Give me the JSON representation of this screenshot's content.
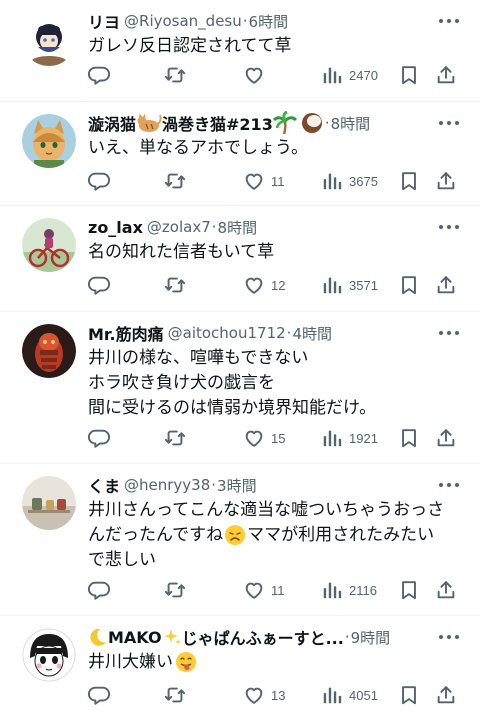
{
  "tweets": [
    {
      "name": "リヨ",
      "handle": "@Riyosan_desu",
      "time": "6時間",
      "lines": [
        "ガレソ反日認定されてて草"
      ],
      "replies": "",
      "retweets": "",
      "likes": "",
      "views": "2470"
    },
    {
      "name": "漩涡猫",
      "name_rest": "渦巻き猫#213",
      "handle": "",
      "time": "8時間",
      "lines": [
        "いえ、単なるアホでしょう。"
      ],
      "replies": "",
      "retweets": "",
      "likes": "11",
      "views": "3675"
    },
    {
      "name": "zo_lax",
      "handle": "@zolax7",
      "time": "8時間",
      "lines": [
        "名の知れた信者もいて草"
      ],
      "replies": "",
      "retweets": "",
      "likes": "12",
      "views": "3571"
    },
    {
      "name": "Mr.筋肉痛",
      "handle": "@aitochou1712",
      "time": "4時間",
      "lines": [
        "井川の様な、喧嘩もできない",
        "ホラ吹き負け犬の戯言を",
        "間に受けるのは情弱か境界知能だけ。"
      ],
      "replies": "",
      "retweets": "",
      "likes": "15",
      "views": "1921"
    },
    {
      "name": "くま",
      "handle": "@henryy38",
      "time": "3時間",
      "lines": [
        "井川さんってこんな適当な嘘ついちゃうおっさ",
        "んだったんですね",
        "ママが利用されたみたい",
        "で悲しい"
      ],
      "replies": "",
      "retweets": "",
      "likes": "11",
      "views": "2116"
    },
    {
      "name": "MAKO",
      "name_rest": "じゃぱんふぁーすと...",
      "handle": "",
      "time": "9時間",
      "lines": [
        "井川大嫌い"
      ],
      "replies": "",
      "retweets": "",
      "likes": "13",
      "views": "4051"
    }
  ],
  "separator": "·",
  "icons": {
    "reply": "reply-icon",
    "retweet": "retweet-icon",
    "like": "heart-icon",
    "views": "views-icon",
    "bookmark": "bookmark-icon",
    "share": "share-icon",
    "more": "more-icon"
  },
  "colors": {
    "text": "#0f1419",
    "secondary": "#536471",
    "divider": "#eff3f4"
  }
}
